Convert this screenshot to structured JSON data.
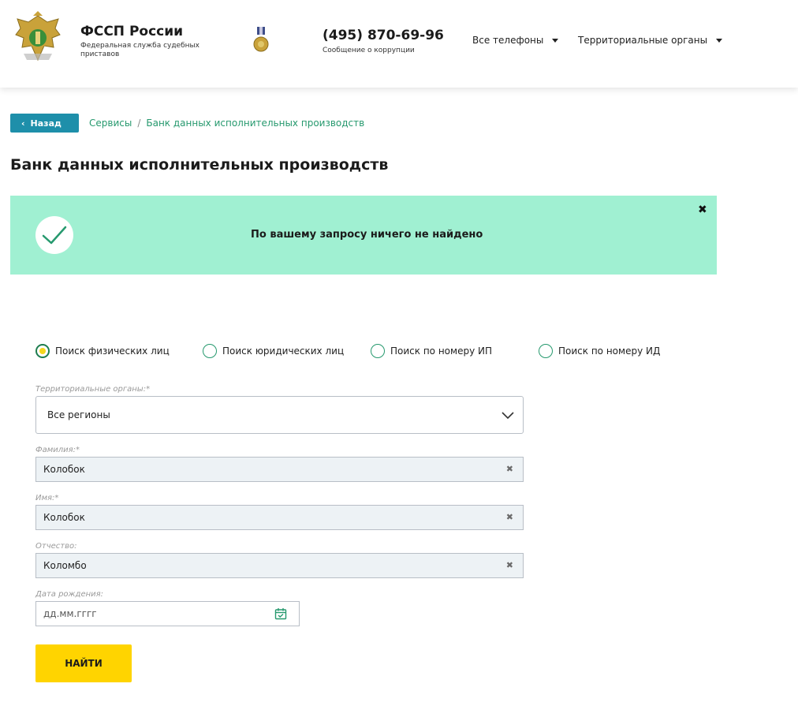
{
  "header": {
    "brand_title": "ФССП России",
    "brand_subtitle": "Федеральная служба судебных приставов",
    "phone": "(495) 870-69-96",
    "phone_caption": "Сообщение о коррупции",
    "nav": [
      {
        "label": "Все телефоны"
      },
      {
        "label": "Территориальные органы"
      }
    ]
  },
  "breadcrumb": {
    "back_label": "Назад",
    "items": [
      "Сервисы",
      "Банк данных исполнительных производств"
    ],
    "separator": "/"
  },
  "page_title": "Банк данных исполнительных производств",
  "alert": {
    "message": "По вашему запросу ничего не найдено",
    "close_glyph": "✖"
  },
  "search_modes": [
    {
      "label": "Поиск физических лиц",
      "selected": true
    },
    {
      "label": "Поиск юридических лиц",
      "selected": false
    },
    {
      "label": "Поиск по номеру ИП",
      "selected": false
    },
    {
      "label": "Поиск по номеру ИД",
      "selected": false
    }
  ],
  "form": {
    "region": {
      "label": "Территориальные органы:*",
      "value": "Все регионы"
    },
    "lastname": {
      "label": "Фамилия:*",
      "value": "Колобок"
    },
    "firstname": {
      "label": "Имя:*",
      "value": "Колобок"
    },
    "patronymic": {
      "label": "Отчество:",
      "value": "Коломбо"
    },
    "birthdate": {
      "label": "Дата рождения:",
      "placeholder": "дд.мм.гггг"
    },
    "clear_glyph": "✖",
    "submit_label": "НАЙТИ"
  },
  "colors": {
    "accent_teal": "#1e8faa",
    "link_green": "#26996e",
    "alert_bg": "#a0f0d2",
    "submit_yellow": "#ffd400",
    "field_bg": "#edf2f5"
  }
}
